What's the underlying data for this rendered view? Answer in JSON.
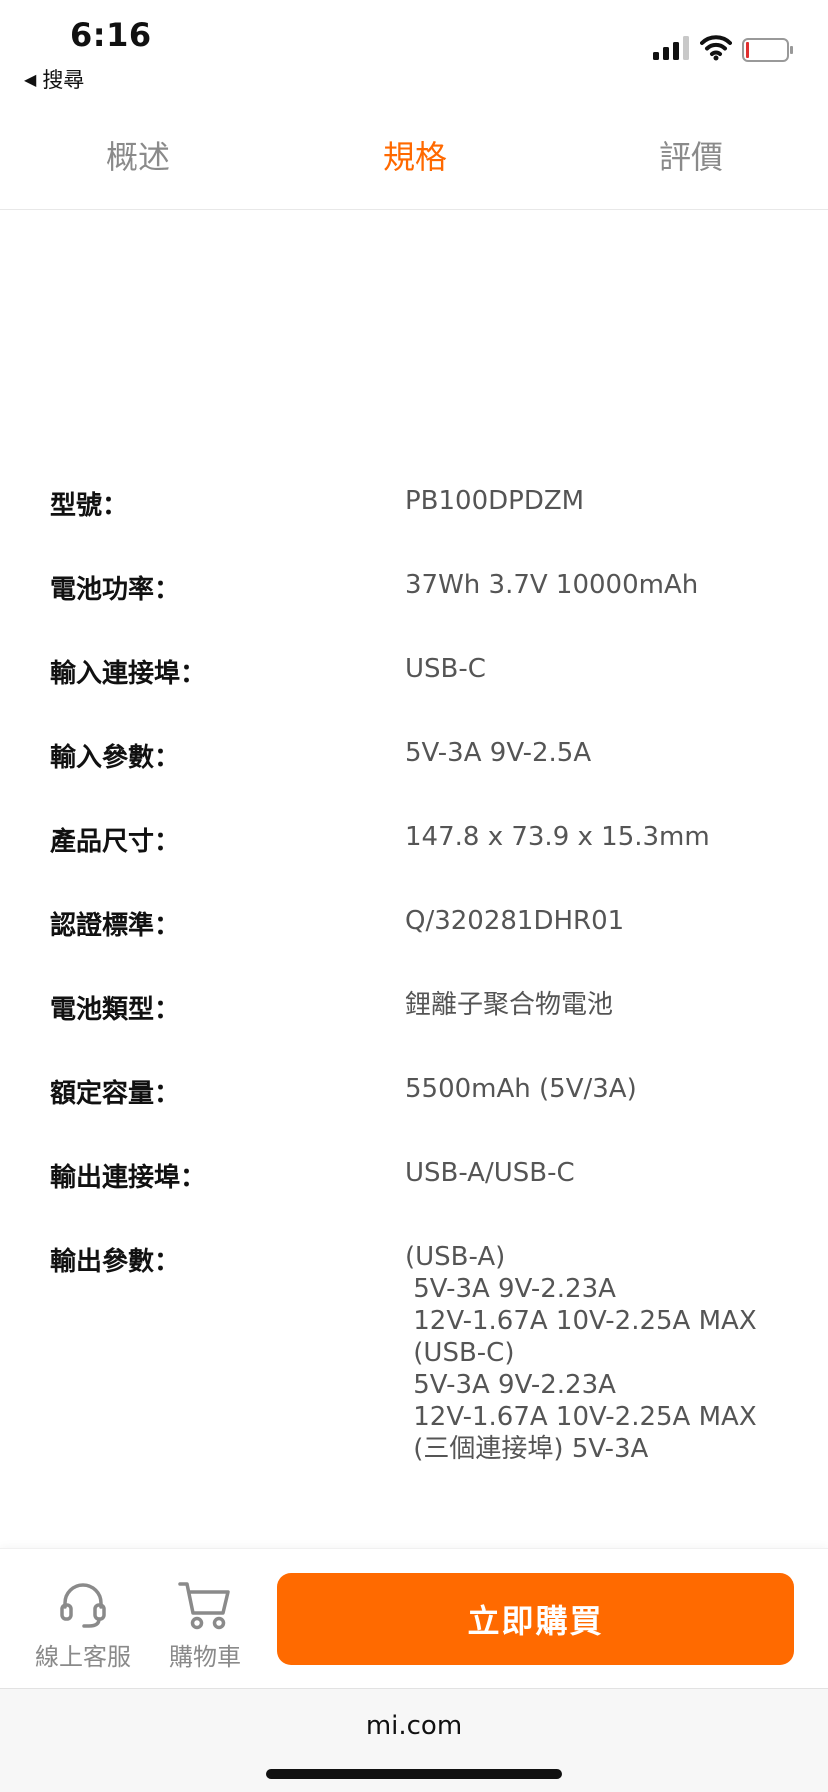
{
  "status_bar": {
    "time": "6:16",
    "back_app": "搜尋",
    "back_glyph": "◀",
    "battery_low_color": "#e03030"
  },
  "tabs": [
    {
      "label": "概述",
      "active": false
    },
    {
      "label": "規格",
      "active": true
    },
    {
      "label": "評價",
      "active": false
    }
  ],
  "specs": [
    {
      "label": "型號：",
      "value": "PB100DPDZM"
    },
    {
      "label": "電池功率：",
      "value": "37Wh 3.7V 10000mAh"
    },
    {
      "label": "輸入連接埠：",
      "value": "USB-C"
    },
    {
      "label": "輸入參數：",
      "value": "5V-3A 9V-2.5A"
    },
    {
      "label": "產品尺寸：",
      "value": "147.8 x 73.9 x 15.3mm"
    },
    {
      "label": "認證標準：",
      "value": "Q/320281DHR01"
    },
    {
      "label": "電池類型：",
      "value": "鋰離子聚合物電池"
    },
    {
      "label": "額定容量：",
      "value": "5500mAh (5V/3A)"
    },
    {
      "label": "輸出連接埠：",
      "value": "USB-A/USB-C"
    },
    {
      "label": "輸出參數：",
      "value": "(USB-A)\n 5V-3A 9V-2.23A\n 12V-1.67A 10V-2.25A MAX\n (USB-C)\n 5V-3A 9V-2.23A\n 12V-1.67A 10V-2.25A MAX\n (三個連接埠) 5V-3A"
    }
  ],
  "actions": {
    "service_label": "線上客服",
    "cart_label": "購物車",
    "buy_label": "立即購買"
  },
  "browser": {
    "url": "mi.com"
  },
  "colors": {
    "accent": "#ff6900",
    "buy_button": "#ff6a00"
  }
}
